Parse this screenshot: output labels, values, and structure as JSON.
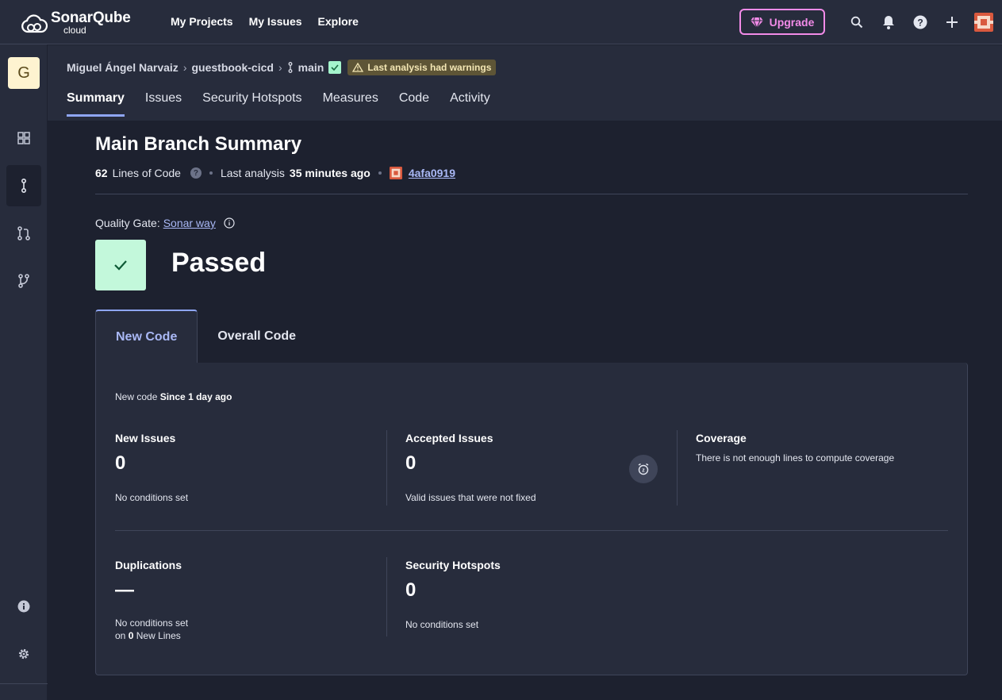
{
  "topbar": {
    "logo_text": "SonarQube",
    "logo_sub": "cloud",
    "nav": [
      "My Projects",
      "My Issues",
      "Explore"
    ],
    "upgrade_label": "Upgrade"
  },
  "sidebar": {
    "org_initial": "G"
  },
  "breadcrumb": {
    "org": "Miguel Ángel Narvaiz",
    "project": "guestbook-cicd",
    "branch": "main",
    "warning": "Last analysis had warnings"
  },
  "tabs": [
    "Summary",
    "Issues",
    "Security Hotspots",
    "Measures",
    "Code",
    "Activity"
  ],
  "summary": {
    "title": "Main Branch Summary",
    "loc_value": "62",
    "loc_label": "Lines of Code",
    "last_analysis_label": "Last analysis",
    "last_analysis_value": "35 minutes ago",
    "commit": "4afa0919",
    "quality_gate_label": "Quality Gate:",
    "quality_gate_name": "Sonar way",
    "status": "Passed"
  },
  "code_tabs": [
    "New Code",
    "Overall Code"
  ],
  "new_code": {
    "label": "New code",
    "since": "Since 1 day ago",
    "new_issues": {
      "title": "New Issues",
      "value": "0",
      "note": "No conditions set"
    },
    "accepted_issues": {
      "title": "Accepted Issues",
      "value": "0",
      "note": "Valid issues that were not fixed"
    },
    "coverage": {
      "title": "Coverage",
      "note": "There is not enough lines to compute coverage"
    },
    "duplications": {
      "title": "Duplications",
      "value": "—",
      "note": "No conditions set",
      "note2_prefix": "on",
      "note2_value": "0",
      "note2_suffix": "New Lines"
    },
    "security_hotspots": {
      "title": "Security Hotspots",
      "value": "0",
      "note": "No conditions set"
    }
  },
  "colors": {
    "accent": "#8fa6f5",
    "upgrade": "#f28be8",
    "passed_bg": "#c3f8db",
    "warning_bg": "#5e5536"
  }
}
